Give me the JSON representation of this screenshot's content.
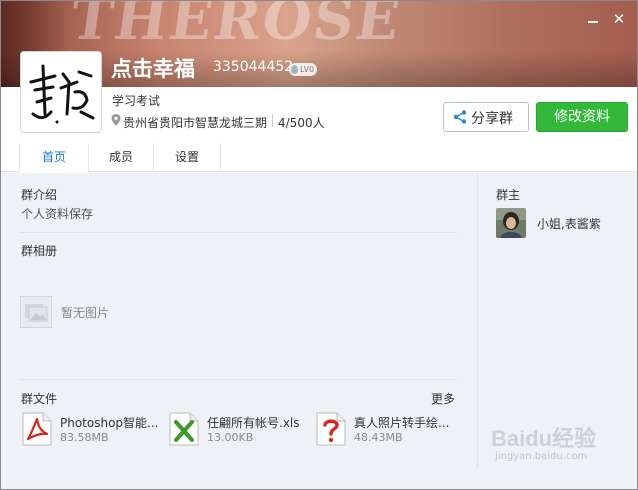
{
  "header": {
    "banner_text": "THEROSE",
    "group_name": "点击幸福",
    "group_id": "335044452",
    "level_badge": "LV0",
    "group_tag": "学习考试",
    "location": "贵州省贵阳市智慧龙城三期",
    "members_count": "4/500人",
    "share_label": "分享群",
    "edit_label": "修改资料",
    "avatar_calligraphy": "幸福"
  },
  "window_controls": {
    "minimize_icon": "minimize-icon",
    "close_icon": "close-icon",
    "close_glyph": "✕"
  },
  "tabs": [
    {
      "label": "首页",
      "active": true
    },
    {
      "label": "成员",
      "active": false
    },
    {
      "label": "设置",
      "active": false
    }
  ],
  "intro": {
    "title": "群介绍",
    "text": "个人资料保存"
  },
  "album": {
    "title": "群相册",
    "empty_text": "暂无图片"
  },
  "files": {
    "title": "群文件",
    "more_label": "更多",
    "items": [
      {
        "name": "Photoshop智能...",
        "size": "83.58MB",
        "icon": "pdf-file-icon"
      },
      {
        "name": "任翩所有帐号.xls",
        "size": "13.00KB",
        "icon": "excel-file-icon"
      },
      {
        "name": "真人照片转手绘...",
        "size": "48.43MB",
        "icon": "unknown-file-icon"
      }
    ]
  },
  "owner": {
    "title": "群主",
    "name": "小姐,表酱紫"
  },
  "watermark": {
    "brand": "Baidu经验",
    "url": "jingyan.baidu.com"
  },
  "colors": {
    "accent_green": "#33b93a",
    "tab_active": "#1a7bd0",
    "pdf_red": "#d9261c",
    "excel_green": "#3c9a2c",
    "unknown_red": "#d9261c"
  }
}
